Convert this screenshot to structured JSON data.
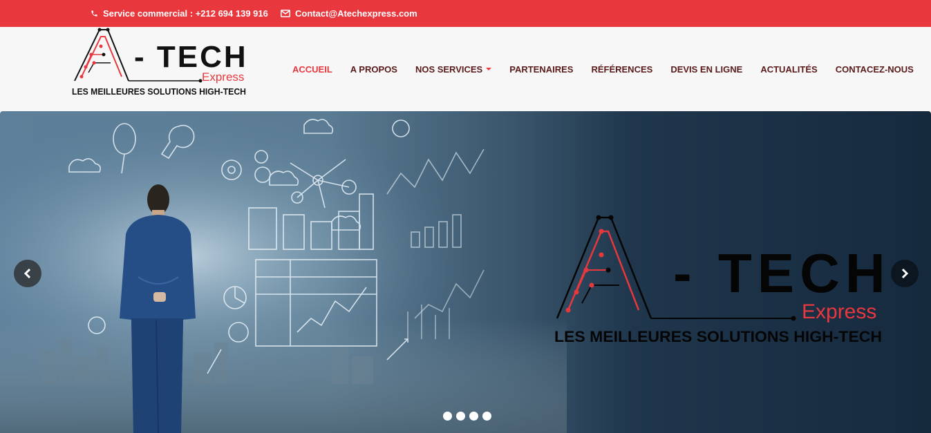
{
  "topbar": {
    "phone_text": "Service commercial : +212 694 139 916",
    "email_text": "Contact@Atechexpress.com",
    "phone_icon": "phone-icon",
    "email_icon": "envelope-icon",
    "background_color": "#e8383e"
  },
  "logo": {
    "letter": "A",
    "name": "- TECH",
    "sub": "Express",
    "tagline": "LES MEILLEURES SOLUTIONS HIGH-TECH"
  },
  "nav": {
    "items": [
      {
        "label": "ACCUEIL",
        "active": true
      },
      {
        "label": "A PROPOS"
      },
      {
        "label": "NOS SERVICES",
        "has_dropdown": true
      },
      {
        "label": "PARTENAIRES"
      },
      {
        "label": "RÉFÉRENCES"
      },
      {
        "label": "DEVIS EN LIGNE"
      },
      {
        "label": "ACTUALITÉS"
      },
      {
        "label": "CONTACEZ-NOUS"
      }
    ]
  },
  "hero": {
    "logo_name": "- TECH",
    "logo_sub": "Express",
    "logo_tagline": "LES MEILLEURES SOLUTIONS HIGH-TECH",
    "prev_icon": "chevron-left-icon",
    "next_icon": "chevron-right-icon",
    "slide_count": 4
  },
  "colors": {
    "accent": "#e8383e",
    "nav_text": "#5a1a1a",
    "hero_dark": "#162a3e"
  }
}
